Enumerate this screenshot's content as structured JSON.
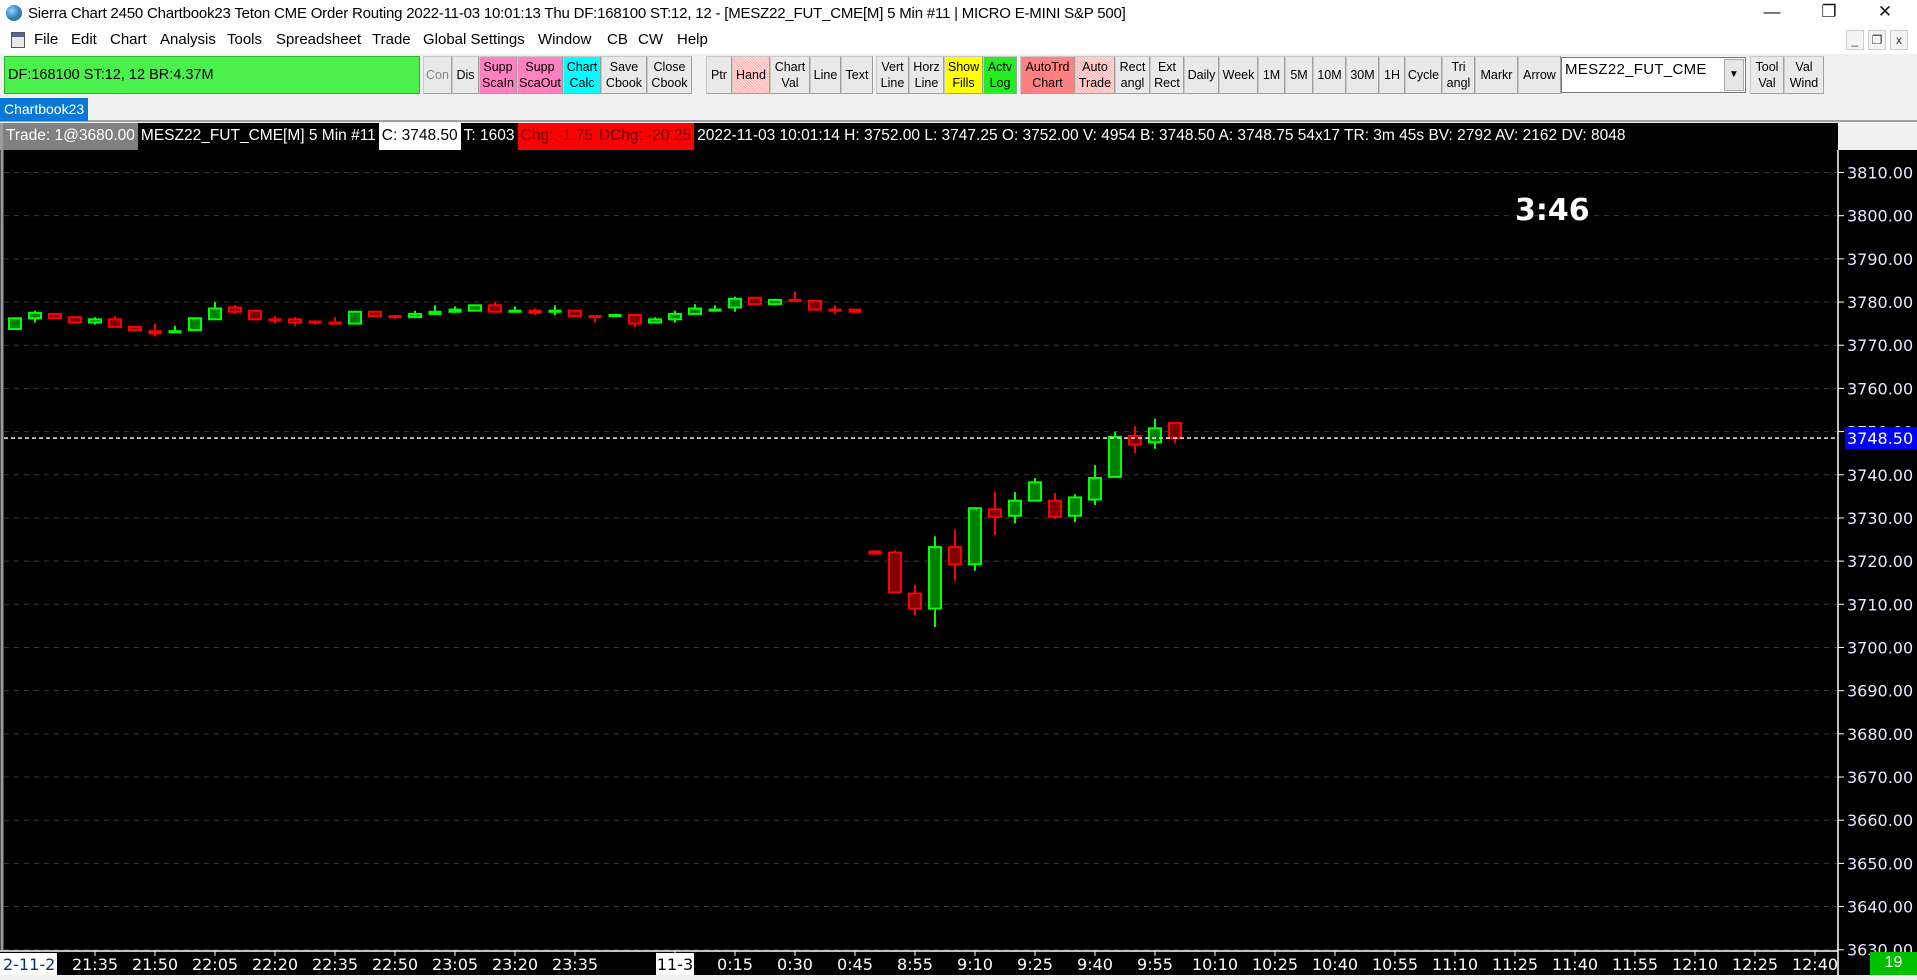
{
  "window": {
    "title": "Sierra Chart 2450 Chartbook23  Teton CME Order Routing 2022-11-03  10:01:13 Thu  DF:168100  ST:12, 12 - [MESZ22_FUT_CME[M]  5 Min   #11 | MICRO E-MINI S&P 500]",
    "controls": {
      "minimize": "—",
      "restore": "❐",
      "close": "✕"
    },
    "mdi_controls": {
      "minimize": "_",
      "restore": "❐",
      "close": "x"
    }
  },
  "menu": [
    "File",
    "Edit",
    "Chart",
    "Analysis",
    "Tools",
    "Spreadsheet",
    "Trade",
    "Global Settings",
    "Window",
    "CB",
    "CW",
    "Help"
  ],
  "status_box": "DF:168100  ST:12, 12  BR:4.37M",
  "toolbar": {
    "buttons": [
      {
        "id": "con",
        "l1": "Con",
        "l2": "",
        "color": "",
        "dim": true
      },
      {
        "id": "dis",
        "l1": "Dis",
        "l2": ""
      },
      {
        "id": "supp-scale-in",
        "l1": "Supp",
        "l2": "ScaIn",
        "color": "#ff80c0"
      },
      {
        "id": "supp-scale-out",
        "l1": "Supp",
        "l2": "ScaOut",
        "color": "#ff80c0"
      },
      {
        "id": "chart-calc",
        "l1": "Chart",
        "l2": "Calc",
        "color": "#00ffff"
      },
      {
        "id": "save-cbook",
        "l1": "Save",
        "l2": "Cbook"
      },
      {
        "id": "close-cbook",
        "l1": "Close",
        "l2": "Cbook"
      },
      {
        "id": "ptr",
        "l1": "Ptr",
        "l2": ""
      },
      {
        "id": "hand",
        "l1": "Hand",
        "l2": "",
        "hatch": true
      },
      {
        "id": "chart-val",
        "l1": "Chart",
        "l2": "Val"
      },
      {
        "id": "line",
        "l1": "Line",
        "l2": ""
      },
      {
        "id": "text",
        "l1": "Text",
        "l2": ""
      },
      {
        "id": "vert-line",
        "l1": "Vert",
        "l2": "Line"
      },
      {
        "id": "horz-line",
        "l1": "Horz",
        "l2": "Line"
      },
      {
        "id": "show-fills",
        "l1": "Show",
        "l2": "Fills",
        "color": "#ffff00"
      },
      {
        "id": "actv-log",
        "l1": "Actv",
        "l2": "Log",
        "color": "#22ee22"
      },
      {
        "id": "autotrd-chart",
        "l1": "AutoTrd",
        "l2": "Chart",
        "color": "#ff8080"
      },
      {
        "id": "auto-trade",
        "l1": "Auto",
        "l2": "Trade",
        "hatch": true
      },
      {
        "id": "rect-angl",
        "l1": "Rect",
        "l2": "angl"
      },
      {
        "id": "ext-rect",
        "l1": "Ext",
        "l2": "Rect"
      },
      {
        "id": "daily",
        "l1": "Daily",
        "l2": ""
      },
      {
        "id": "week",
        "l1": "Week",
        "l2": ""
      },
      {
        "id": "1m",
        "l1": "1M",
        "l2": ""
      },
      {
        "id": "5m",
        "l1": "5M",
        "l2": ""
      },
      {
        "id": "10m",
        "l1": "10M",
        "l2": ""
      },
      {
        "id": "30m",
        "l1": "30M",
        "l2": ""
      },
      {
        "id": "1h",
        "l1": "1H",
        "l2": ""
      },
      {
        "id": "cycle",
        "l1": "Cycle",
        "l2": ""
      },
      {
        "id": "tri-angl",
        "l1": "Tri",
        "l2": "angl"
      },
      {
        "id": "markr",
        "l1": "Markr",
        "l2": ""
      },
      {
        "id": "arrow",
        "l1": "Arrow",
        "l2": ""
      },
      {
        "id": "symbol-combo",
        "combo": true
      },
      {
        "id": "tool-val",
        "l1": "Tool",
        "l2": "Val"
      },
      {
        "id": "val-wind",
        "l1": "Val",
        "l2": "Wind"
      }
    ],
    "symbol_value": "MESZ22_FUT_CME"
  },
  "chartbook_tab": "Chartbook23",
  "infobar": [
    {
      "text": "Trade: 1@3680.00",
      "bg": "#808080",
      "fg": "#ffffff"
    },
    {
      "text": "MESZ22_FUT_CME[M]  5 Min   #11",
      "bg": "#000000",
      "fg": "#ffffff"
    },
    {
      "text": "C: 3748.50",
      "bg": "#ffffff",
      "fg": "#000000"
    },
    {
      "text": "T: 1603",
      "bg": "#000000",
      "fg": "#ffffff"
    },
    {
      "text": "Chg: -1.75",
      "bg": "#ff0000",
      "fg": "#600000"
    },
    {
      "text": "DChg: -20.25",
      "bg": "#ff0000",
      "fg": "#600000"
    },
    {
      "text": "2022-11-03 10:01:14 H: 3752.00 L: 3747.25 O: 3752.00 V: 4954 B: 3748.50 A: 3748.75 54x17 TR: 3m 45s BV: 2792 AV: 2162 DV: 8048",
      "bg": "#000000",
      "fg": "#ffffff"
    }
  ],
  "countdown": "3:46",
  "bar_count": "19",
  "colors": {
    "up_fill": "#008000",
    "up_line": "#00ff00",
    "down_fill": "#800000",
    "down_line": "#ff0000",
    "last_price_bg": "#0000ff",
    "grid": "#3a3a3a"
  },
  "chart_data": {
    "type": "candlestick",
    "symbol": "MESZ22_FUT_CME[M]",
    "interval": "5 Min",
    "ylim": [
      3628,
      3815
    ],
    "y_ticks": [
      3810,
      3800,
      3790,
      3780,
      3770,
      3760,
      3750,
      3740,
      3730,
      3720,
      3710,
      3700,
      3690,
      3680,
      3670,
      3660,
      3650,
      3640,
      3630
    ],
    "y_tick_labels": [
      "3810.00",
      "3800.00",
      "3790.00",
      "3780.00",
      "3770.00",
      "3760.00",
      "3750.00",
      "3740.00",
      "3730.00",
      "3720.00",
      "3710.00",
      "3700.00",
      "3690.00",
      "3680.00",
      "3670.00",
      "3660.00",
      "3650.00",
      "3640.00",
      "3630.00"
    ],
    "last_price": 3748.5,
    "last_price_label": "3748.50",
    "ohlc": [
      [
        3773.75,
        3776.25,
        3773.75,
        3776.25
      ],
      [
        3776.25,
        3778,
        3775.25,
        3777.5
      ],
      [
        3777.25,
        3777.25,
        3776.25,
        3776.25
      ],
      [
        3776.5,
        3776.75,
        3775,
        3775.25
      ],
      [
        3775.25,
        3776.5,
        3774.75,
        3776
      ],
      [
        3776,
        3776.75,
        3774,
        3774.25
      ],
      [
        3774.25,
        3774.5,
        3773.25,
        3773.5
      ],
      [
        3773.25,
        3775,
        3772,
        3772.75
      ],
      [
        3773,
        3774.5,
        3773,
        3773.25
      ],
      [
        3773.5,
        3776.25,
        3773.5,
        3776.25
      ],
      [
        3776,
        3780,
        3776,
        3778.5
      ],
      [
        3778.75,
        3779.25,
        3777.25,
        3777.75
      ],
      [
        3778,
        3778.25,
        3776,
        3776
      ],
      [
        3776,
        3776.75,
        3775,
        3775.75
      ],
      [
        3776,
        3776.5,
        3774.5,
        3775.25
      ],
      [
        3775.5,
        3775.75,
        3774.75,
        3775.25
      ],
      [
        3775.25,
        3776.5,
        3775,
        3775
      ],
      [
        3775,
        3778,
        3775,
        3777.75
      ],
      [
        3777.75,
        3778,
        3776.5,
        3776.75
      ],
      [
        3776.75,
        3777,
        3776,
        3776.5
      ],
      [
        3776.5,
        3778,
        3776.5,
        3777.25
      ],
      [
        3777.25,
        3779.25,
        3777.25,
        3777.75
      ],
      [
        3777.75,
        3779,
        3777.5,
        3778.25
      ],
      [
        3778,
        3779.25,
        3778,
        3779.25
      ],
      [
        3779.25,
        3780,
        3777.75,
        3777.75
      ],
      [
        3777.75,
        3779,
        3777.75,
        3778
      ],
      [
        3778,
        3778.5,
        3777,
        3777.5
      ],
      [
        3777.75,
        3779.25,
        3777,
        3778
      ],
      [
        3778,
        3778.25,
        3776.75,
        3776.75
      ],
      [
        3776.75,
        3777,
        3775.25,
        3776.5
      ],
      [
        3776.75,
        3777.25,
        3776.75,
        3777
      ],
      [
        3777,
        3777.25,
        3774.25,
        3775
      ],
      [
        3775.25,
        3776.5,
        3775.25,
        3776
      ],
      [
        3776,
        3778,
        3775.25,
        3777.25
      ],
      [
        3777.25,
        3779.5,
        3777.25,
        3778.5
      ],
      [
        3778,
        3779.25,
        3778,
        3778.25
      ],
      [
        3778.75,
        3781.25,
        3777.75,
        3780.75
      ],
      [
        3781,
        3781,
        3779.5,
        3779.5
      ],
      [
        3779.5,
        3780.75,
        3779.5,
        3780.5
      ],
      [
        3780.5,
        3782.5,
        3780,
        3780.25
      ],
      [
        3780.25,
        3780.25,
        3778.25,
        3778.25
      ],
      [
        3778.25,
        3779.25,
        3777.25,
        3778
      ],
      [
        3778.25,
        3778.25,
        3777.75,
        3777.75
      ],
      [
        3722.25,
        3722.5,
        3721.5,
        3721.75
      ],
      [
        3722,
        3722.5,
        3712.5,
        3712.75
      ],
      [
        3712.5,
        3714.5,
        3707.5,
        3709
      ],
      [
        3709,
        3725.75,
        3704.75,
        3723.25
      ],
      [
        3723.25,
        3727.25,
        3715.5,
        3719.25
      ],
      [
        3719.25,
        3732.5,
        3717.75,
        3732.25
      ],
      [
        3732,
        3736,
        3726,
        3730.25
      ],
      [
        3730.5,
        3736,
        3728.75,
        3734
      ],
      [
        3734,
        3739.25,
        3734,
        3738.25
      ],
      [
        3734,
        3735.75,
        3729.75,
        3730.25
      ],
      [
        3730.5,
        3735.5,
        3729,
        3734.75
      ],
      [
        3734.25,
        3742.25,
        3733,
        3739.25
      ],
      [
        3739.5,
        3750,
        3739.5,
        3748.75
      ],
      [
        3749,
        3751.25,
        3745,
        3747
      ],
      [
        3747.5,
        3753,
        3746,
        3750.75
      ],
      [
        3752,
        3752,
        3747.25,
        3748.5
      ]
    ],
    "x_labels": [
      {
        "bar": 4,
        "text": "21:35"
      },
      {
        "bar": 7,
        "text": "21:50"
      },
      {
        "bar": 10,
        "text": "22:05"
      },
      {
        "bar": 13,
        "text": "22:20"
      },
      {
        "bar": 16,
        "text": "22:35"
      },
      {
        "bar": 19,
        "text": "22:50"
      },
      {
        "bar": 22,
        "text": "23:05"
      },
      {
        "bar": 25,
        "text": "23:20"
      },
      {
        "bar": 28,
        "text": "23:35"
      },
      {
        "bar": 33,
        "text": "11-3",
        "date": true
      },
      {
        "bar": 36,
        "text": "0:15"
      },
      {
        "bar": 39,
        "text": "0:30"
      },
      {
        "bar": 42,
        "text": "0:45"
      },
      {
        "bar": 45,
        "text": "8:55"
      },
      {
        "bar": 48,
        "text": "9:10"
      },
      {
        "bar": 51,
        "text": "9:25"
      },
      {
        "bar": 54,
        "text": "9:40"
      },
      {
        "bar": 57,
        "text": "9:55"
      },
      {
        "bar": 60,
        "text": "10:10"
      },
      {
        "bar": 63,
        "text": "10:25"
      },
      {
        "bar": 66,
        "text": "10:40"
      },
      {
        "bar": 69,
        "text": "10:55"
      },
      {
        "bar": 72,
        "text": "11:10"
      },
      {
        "bar": 75,
        "text": "11:25"
      },
      {
        "bar": 78,
        "text": "11:40"
      },
      {
        "bar": 81,
        "text": "11:55"
      },
      {
        "bar": 84,
        "text": "12:10"
      },
      {
        "bar": 87,
        "text": "12:25"
      },
      {
        "bar": 90,
        "text": "12:40"
      }
    ],
    "start_date_label": "2-11-2"
  }
}
